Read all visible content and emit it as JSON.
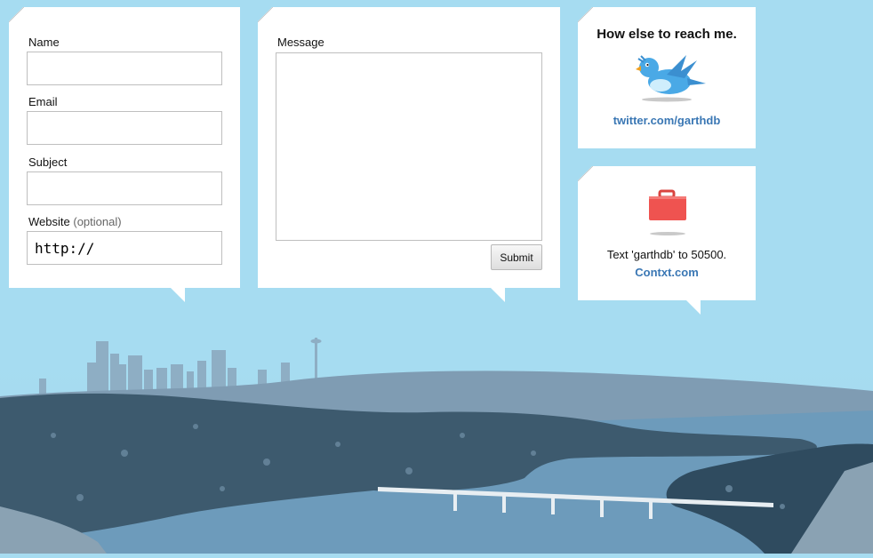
{
  "contact_form": {
    "name_label": "Name",
    "email_label": "Email",
    "subject_label": "Subject",
    "website_label": "Website",
    "website_optional": "(optional)",
    "website_value": "http://",
    "message_label": "Message",
    "submit_label": "Submit"
  },
  "twitter_card": {
    "heading": "How else to reach me.",
    "icon": "twitter-bird-icon",
    "link_text": "twitter.com/garthdb"
  },
  "contxt_card": {
    "icon": "red-briefcase-icon",
    "text": "Text 'garthdb' to 50500.",
    "link_text": "Contxt.com"
  },
  "colors": {
    "background": "#a6dcf1",
    "link": "#3a77b4",
    "twitter_blue": "#3aa0e0",
    "briefcase_red": "#ef5350",
    "landscape_dark": "#3d5a6e",
    "water": "#6d9bbb"
  }
}
